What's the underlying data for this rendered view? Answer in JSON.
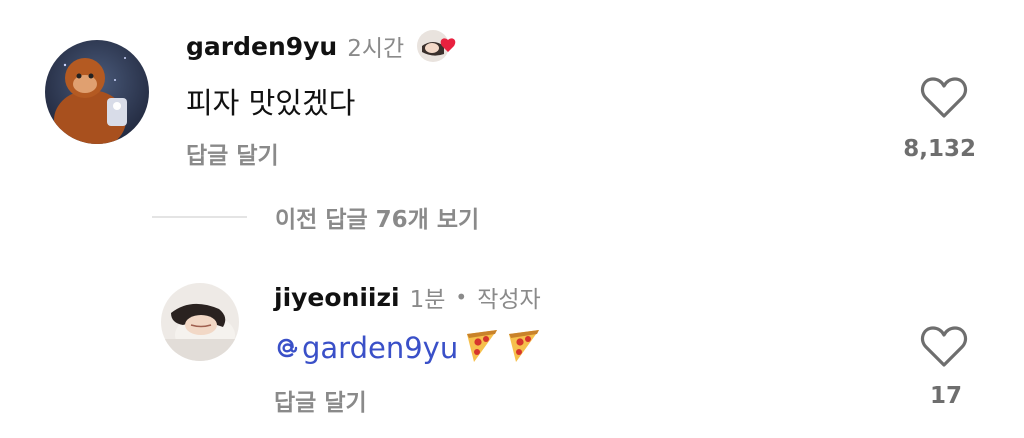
{
  "comments": [
    {
      "username": "garden9yu",
      "time": "2시간",
      "text": "피자 맛있겠다",
      "reply_label": "답글 달기",
      "likes": "8,132",
      "liked_by_author_icon": "author-avatar-heart-icon"
    },
    {
      "username": "jiyeoniizi",
      "time": "1분",
      "separator": "•",
      "author_badge": "작성자",
      "mention": "garden9yu",
      "reply_label": "답글 달기",
      "likes": "17",
      "emojis": [
        "pizza-icon",
        "pizza-icon"
      ]
    }
  ],
  "view_previous_replies": "이전 답글 76개 보기",
  "colors": {
    "mention": "#3a50c8",
    "secondary_text": "#8a8a8a",
    "heart_badge": "#e8213f"
  }
}
